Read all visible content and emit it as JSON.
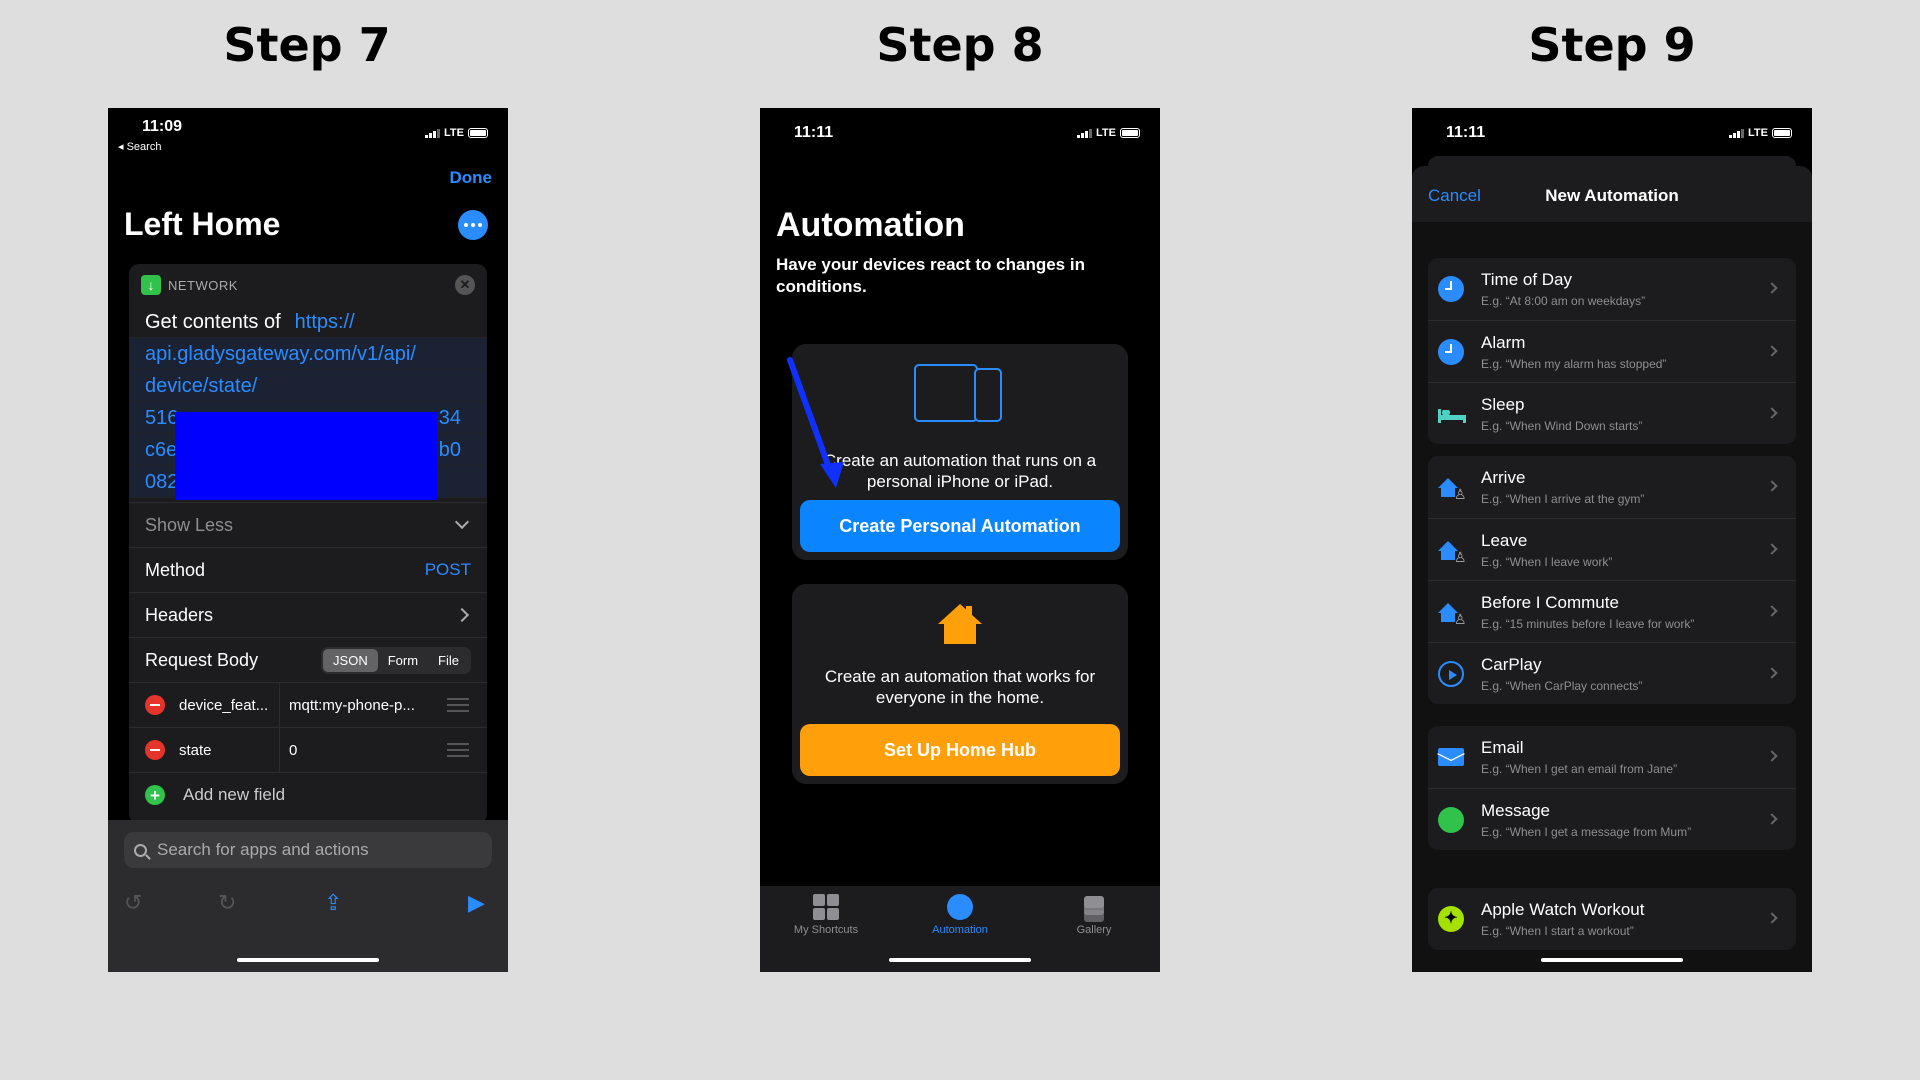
{
  "steps": [
    "Step 7",
    "Step 8",
    "Step 9"
  ],
  "step7": {
    "time": "11:09",
    "back": "◂ Search",
    "network": "LTE",
    "done": "Done",
    "title": "Left Home",
    "action_category": "NETWORK",
    "get_contents_of": "Get contents of",
    "url_lines": [
      "https://",
      "api.gladysgateway.com/v1/api/",
      "device/state/",
      "516",
      "c6e",
      "082"
    ],
    "url_tails": [
      "34",
      "b0"
    ],
    "show_less": "Show Less",
    "method_label": "Method",
    "method_value": "POST",
    "headers_label": "Headers",
    "request_body_label": "Request Body",
    "body_types": [
      "JSON",
      "Form",
      "File"
    ],
    "fields": [
      {
        "key": "device_feat...",
        "value": "mqtt:my-phone-p..."
      },
      {
        "key": "state",
        "value": "0"
      }
    ],
    "add_field": "Add new field",
    "search_placeholder": "Search for apps and actions"
  },
  "step8": {
    "time": "11:11",
    "network": "LTE",
    "title": "Automation",
    "subtitle": "Have your devices react to changes in conditions.",
    "personal_text": "Create an automation that runs on a personal iPhone or iPad.",
    "personal_button": "Create Personal Automation",
    "home_text": "Create an automation that works for everyone in the home.",
    "home_button": "Set Up Home Hub",
    "tabs": [
      "My Shortcuts",
      "Automation",
      "Gallery"
    ],
    "colors": {
      "accent": "#2b8cff",
      "home": "#ff9f0a"
    }
  },
  "step9": {
    "time": "11:11",
    "network": "LTE",
    "cancel": "Cancel",
    "title": "New Automation",
    "groups": [
      [
        {
          "name": "Time of Day",
          "example": "E.g. “At 8:00 am on weekdays”",
          "icon": "clock-icon"
        },
        {
          "name": "Alarm",
          "example": "E.g. “When my alarm has stopped”",
          "icon": "alarm-icon"
        },
        {
          "name": "Sleep",
          "example": "E.g. “When Wind Down starts”",
          "icon": "bed-icon"
        }
      ],
      [
        {
          "name": "Arrive",
          "example": "E.g. “When I arrive at the gym”",
          "icon": "arrive-icon"
        },
        {
          "name": "Leave",
          "example": "E.g. “When I leave work”",
          "icon": "leave-icon"
        },
        {
          "name": "Before I Commute",
          "example": "E.g. “15 minutes before I leave for work”",
          "icon": "commute-icon"
        },
        {
          "name": "CarPlay",
          "example": "E.g. “When CarPlay connects”",
          "icon": "carplay-icon"
        }
      ],
      [
        {
          "name": "Email",
          "example": "E.g. “When I get an email from Jane”",
          "icon": "mail-icon"
        },
        {
          "name": "Message",
          "example": "E.g. “When I get a message from Mum”",
          "icon": "message-icon"
        }
      ],
      [
        {
          "name": "Apple Watch Workout",
          "example": "E.g. “When I start a workout”",
          "icon": "workout-icon"
        }
      ]
    ]
  }
}
